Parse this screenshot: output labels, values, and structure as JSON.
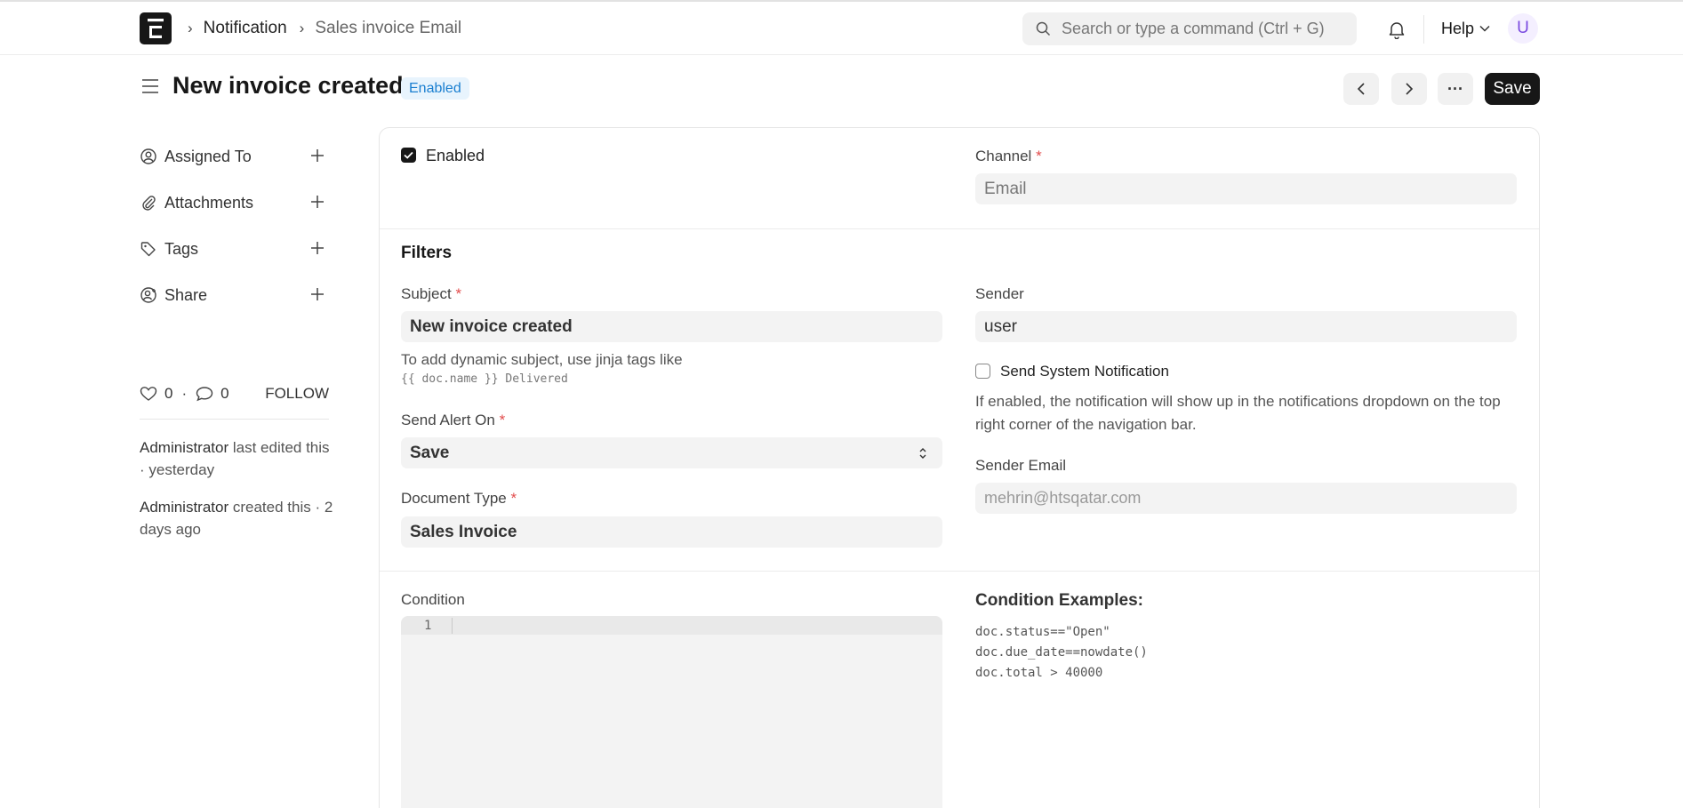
{
  "navbar": {
    "breadcrumbs": [
      "Notification",
      "Sales invoice Email"
    ],
    "search_placeholder": "Search or type a command (Ctrl + G)",
    "help_label": "Help",
    "avatar_initial": "U"
  },
  "page": {
    "title": "New invoice created",
    "status_badge": "Enabled",
    "save_label": "Save",
    "more_label": "···"
  },
  "sidebar": {
    "items": [
      {
        "label": "Assigned To",
        "icon": "assign-user-icon"
      },
      {
        "label": "Attachments",
        "icon": "paperclip-icon"
      },
      {
        "label": "Tags",
        "icon": "tag-icon"
      },
      {
        "label": "Share",
        "icon": "share-user-icon"
      }
    ],
    "likes": "0",
    "comments": "0",
    "separator": "·",
    "follow_label": "FOLLOW",
    "activity": [
      {
        "user": "Administrator",
        "text": " last edited this · yesterday"
      },
      {
        "user": "Administrator",
        "text": " created this · 2 days ago"
      }
    ]
  },
  "form": {
    "enabled_label": "Enabled",
    "enabled_checked": true,
    "channel": {
      "label": "Channel",
      "value": "Email"
    },
    "filters_heading": "Filters",
    "subject": {
      "label": "Subject",
      "value": "New invoice created"
    },
    "subject_help": "To add dynamic subject, use jinja tags like",
    "subject_help_code": "{{ doc.name }} Delivered",
    "send_alert_on": {
      "label": "Send Alert On",
      "value": "Save"
    },
    "document_type": {
      "label": "Document Type",
      "value": "Sales Invoice"
    },
    "sender": {
      "label": "Sender",
      "value": "user"
    },
    "send_system_notification": {
      "label": "Send System Notification",
      "checked": false
    },
    "system_notification_help": [
      "If enabled, the notification will show up in the notifications dropdown on the top",
      "right corner of the navigation bar."
    ],
    "sender_email": {
      "label": "Sender Email",
      "placeholder": "mehrin@htsqatar.com"
    },
    "condition": {
      "label": "Condition",
      "line_number": "1"
    },
    "condition_examples": {
      "heading": "Condition Examples:",
      "lines": [
        "doc.status==\"Open\"",
        "doc.due_date==nowdate()",
        "doc.total > 40000"
      ]
    }
  },
  "colors": {
    "primary": "#171717",
    "badge_bg": "#e8f4fd",
    "badge_text": "#1a7fd0",
    "required": "#e24c4c",
    "avatar": "#7a4ae0"
  }
}
